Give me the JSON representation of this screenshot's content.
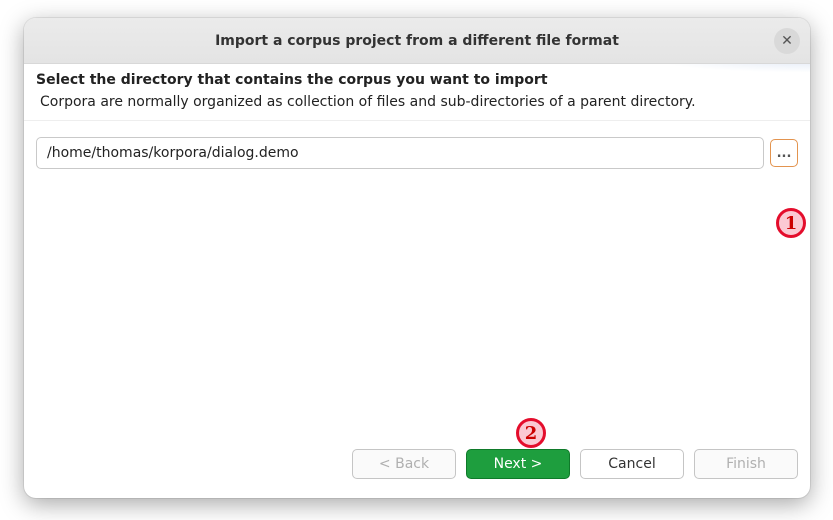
{
  "dialog": {
    "title": "Import a corpus project from a different file format",
    "close_label": "✕"
  },
  "header": {
    "title": "Select the directory that contains the corpus you want to import",
    "description": "Corpora are normally organized as collection of files and sub-directories of a parent directory."
  },
  "path": {
    "value": "/home/thomas/korpora/dialog.demo",
    "browse_label": "..."
  },
  "buttons": {
    "back": "< Back",
    "next": "Next >",
    "cancel": "Cancel",
    "finish": "Finish"
  },
  "annotations": {
    "one": "1",
    "two": "2"
  }
}
